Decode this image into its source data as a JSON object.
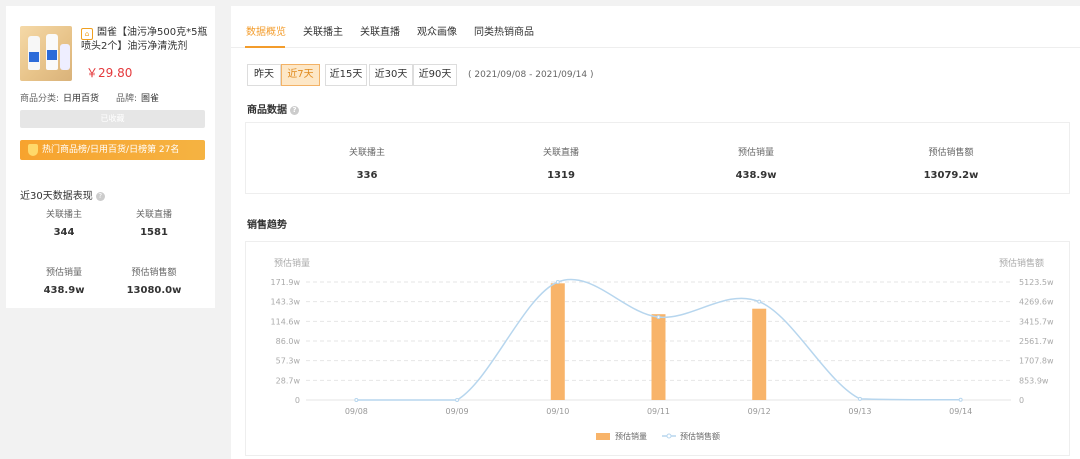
{
  "product": {
    "shop_icon": "shop-icon",
    "title": "圄雀【油污净500克*5瓶喷头2个】油污净清洗剂",
    "price": "￥29.80",
    "category_label": "商品分类:",
    "category_value": "日用百货",
    "brand_label": "品牌:",
    "brand_value": "圄雀",
    "grey_button": "已收藏",
    "rank_text": "热门商品榜/日用百货/日榜第 27名"
  },
  "left_stats": {
    "title": "近30天数据表现",
    "items": [
      {
        "label": "关联播主",
        "value": "344"
      },
      {
        "label": "关联直播",
        "value": "1581"
      },
      {
        "label": "预估销量",
        "value": "438.9w"
      },
      {
        "label": "预估销售额",
        "value": "13080.0w"
      }
    ]
  },
  "tabs": [
    "数据概览",
    "关联播主",
    "关联直播",
    "观众画像",
    "同类热销商品"
  ],
  "active_tab": 0,
  "date_ranges": [
    "昨天",
    "近7天",
    "近15天",
    "近30天",
    "近90天"
  ],
  "active_range": 1,
  "date_text": "( 2021/09/08 - 2021/09/14 )",
  "product_data": {
    "title": "商品数据",
    "items": [
      {
        "label": "关联播主",
        "value": "336"
      },
      {
        "label": "关联直播",
        "value": "1319"
      },
      {
        "label": "预估销量",
        "value": "438.9w"
      },
      {
        "label": "预估销售额",
        "value": "13079.2w"
      }
    ]
  },
  "trend_title": "销售趋势",
  "colors": {
    "accent": "#f39c2b",
    "bar": "#f8b46a",
    "line": "#b7d6ee"
  },
  "chart_data": {
    "type": "bar",
    "categories": [
      "09/08",
      "09/09",
      "09/10",
      "09/11",
      "09/12",
      "09/13",
      "09/14"
    ],
    "left_axis_label": "预估销量",
    "right_axis_label": "预估销售额",
    "left_ticks": [
      "0",
      "28.7w",
      "57.3w",
      "86.0w",
      "114.6w",
      "143.3w",
      "171.9w"
    ],
    "right_ticks": [
      "0",
      "853.9w",
      "1707.8w",
      "2561.7w",
      "3415.7w",
      "4269.6w",
      "5123.5w"
    ],
    "ylim_left": [
      0,
      171.9
    ],
    "ylim_right": [
      0,
      5123.5
    ],
    "series": [
      {
        "name": "预估销量",
        "type": "bar",
        "values": [
          0,
          0,
          170.0,
          125.0,
          133.0,
          0,
          0
        ]
      },
      {
        "name": "预估销售额",
        "type": "line",
        "values": [
          0,
          0,
          5123.5,
          3600.0,
          4269.6,
          50,
          10
        ]
      }
    ],
    "legend_position": "bottom",
    "grid": true
  }
}
